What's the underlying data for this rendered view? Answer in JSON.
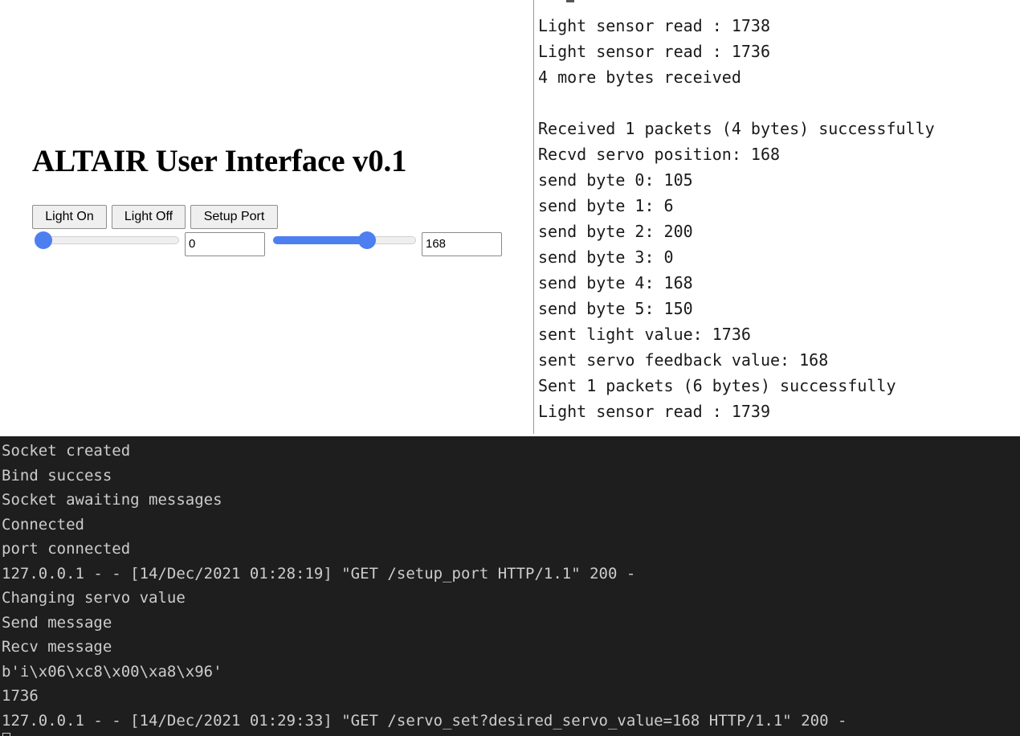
{
  "web_ui": {
    "title": "ALTAIR User Interface v0.1",
    "buttons": {
      "light_on": "Light On",
      "light_off": "Light Off",
      "setup_port": "Setup Port"
    },
    "light_slider": {
      "value": 0,
      "fraction": 0.0
    },
    "light_input": {
      "value": "0"
    },
    "servo_slider": {
      "value": 168,
      "fraction": 0.66
    },
    "servo_input": {
      "value": "168"
    },
    "accent_color": "#4d7ff0"
  },
  "serial_monitor": {
    "lines": [
      "Light sensor read : 1738",
      "Light sensor read : 1736",
      "4 more bytes received",
      "",
      "Received 1 packets (4 bytes) successfully",
      "Recvd servo position: 168",
      "send byte 0: 105",
      "send byte 1: 6",
      "send byte 2: 200",
      "send byte 3: 0",
      "send byte 4: 168",
      "send byte 5: 150",
      "sent light value: 1736",
      "sent servo feedback value: 168",
      "Sent 1 packets (6 bytes) successfully",
      "Light sensor read : 1739"
    ]
  },
  "terminal": {
    "background": "#1e1e1e",
    "lines": [
      "Socket created",
      "Bind success",
      "Socket awaiting messages",
      "Connected",
      "port connected",
      "127.0.0.1 - - [14/Dec/2021 01:28:19] \"GET /setup_port HTTP/1.1\" 200 -",
      "Changing servo value",
      "Send message",
      "Recv message",
      "b'i\\x06\\xc8\\x00\\xa8\\x96'",
      "1736",
      "127.0.0.1 - - [14/Dec/2021 01:29:33] \"GET /servo_set?desired_servo_value=168 HTTP/1.1\" 200 -"
    ]
  }
}
